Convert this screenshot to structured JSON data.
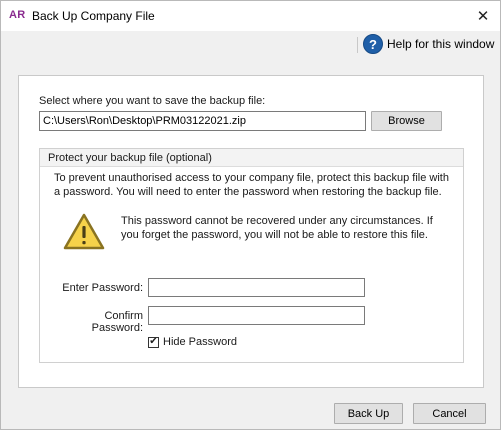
{
  "window": {
    "logo": "AR",
    "title": "Back Up Company File",
    "close_glyph": "✕",
    "help_icon": "?",
    "help_label": "Help for this window"
  },
  "form": {
    "save_label": "Select where you want to save the backup file:",
    "path_value": "C:\\Users\\Ron\\Desktop\\PRM03122021.zip",
    "browse_label": "Browse",
    "group_title": "Protect your backup file (optional)",
    "intro": "To prevent unauthorised access to your company file, protect this backup file with a password. You will need to enter the password when restoring the backup file.",
    "warning": "This password cannot be recovered under any circumstances. If you forget the password, you will not be able to restore this file.",
    "enter_password_label": "Enter Password:",
    "confirm_password_label": "Confirm Password:",
    "enter_password_value": "",
    "confirm_password_value": "",
    "hide_password_label": "Hide Password",
    "hide_password_checked": true
  },
  "footer": {
    "backup_label": "Back Up",
    "cancel_label": "Cancel"
  },
  "colors": {
    "logo": "#8a2b8f",
    "help_icon": "#1f5fa8",
    "warning_fill": "#f6d24a",
    "warning_stroke": "#8a7321"
  },
  "icons": {
    "close": "close-icon",
    "help": "help-icon",
    "warning": "warning-icon",
    "checkmark": "checkmark-icon"
  }
}
